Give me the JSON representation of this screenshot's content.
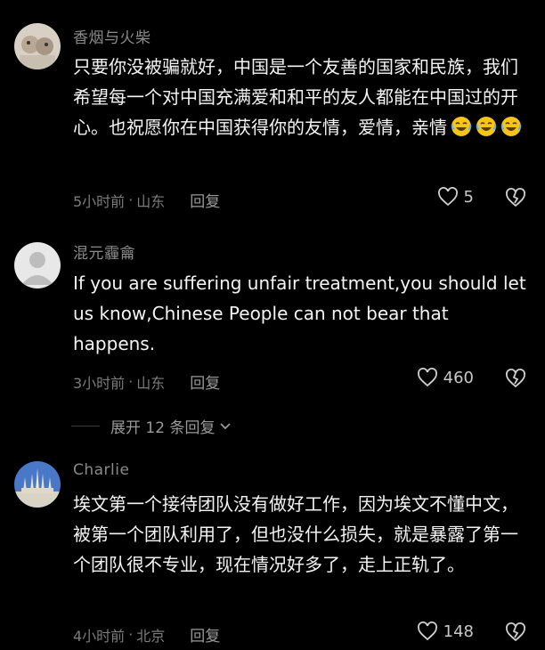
{
  "comments": [
    {
      "username": "香烟与火柴",
      "text": "只要你没被骗就好，中国是一个友善的国家和民族，我们希望每一个对中国充满爱和和平的友人都能在中国过的开心。也祝愿你在中国获得你的友情，爱情，亲情",
      "emoji_count": 3,
      "time": "5小时前",
      "location": "山东",
      "reply_label": "回复",
      "likes": "5"
    },
    {
      "username": "混元霾龠",
      "text": "If you are suffering unfair treatment,you should let us know,Chinese People can not bear that happens.",
      "time": "3小时前",
      "location": "山东",
      "reply_label": "回复",
      "likes": "460"
    },
    {
      "username": "Charlie",
      "text": "埃文第一个接待团队没有做好工作，因为埃文不懂中文，被第一个团队利用了，但也没什么损失，就是暴露了第一个团队很不专业，现在情况好多了，走上正轨了。",
      "time": "4小时前",
      "location": "北京",
      "reply_label": "回复",
      "likes": "148"
    }
  ],
  "expand_replies": "展开 12 条回复",
  "meta_separator": "·",
  "colors": {
    "background": "#000000",
    "username": "#8a8a8a",
    "text": "#f4f4f4",
    "meta": "#7c7c7c"
  }
}
